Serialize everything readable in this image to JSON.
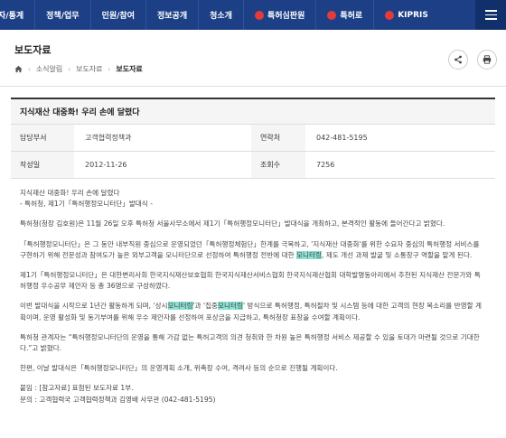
{
  "nav": {
    "items": [
      "자/통계",
      "정책/업무",
      "민원/참여",
      "정보공개",
      "청소개"
    ],
    "ext_links": [
      "특허심판원",
      "특허로",
      "KIPRIS"
    ]
  },
  "header": {
    "title": "보도자료",
    "breadcrumb": [
      "소식알림",
      "보도자료",
      "보도자료"
    ]
  },
  "article": {
    "title": "지식재산 대중화! 우리 손에 달렸다",
    "dept_label": "담당부서",
    "dept_value": "고객협력정책과",
    "contact_label": "연락처",
    "contact_value": "042-481-5195",
    "date_label": "작성일",
    "date_value": "2012-11-26",
    "views_label": "조회수",
    "views_value": "7256",
    "body": {
      "line1": "지식재산 대중화! 우리 손에 달렸다",
      "line2": "- 특허청, 제1기「특허행정모니터단」발대식 -",
      "p1": "특허청(청장 김호원)은 11월 26일 오후 특허청 서울사무소에서 제1기「특허행정모니터단」발대식을 개최하고, 본격적인 활동에 들어간다고 밝혔다.",
      "p2a": "「특허행정모니터단」은 그 동안 내부직원 중심으로 운영되었던「특허행정체험단」한계를 극복하고, '지식재산 대중화'를 위한 수요자 중심의 특허행정 서비스를 구현하기 위해 전문성과 참여도가 높은 외부고객을 모니터단으로 선정하여 특허행정 전반에 대한 ",
      "p2hl": "모니터링",
      "p2b": ", 제도 개선 과제 발굴 및 소통창구 역할을 맡게 된다.",
      "p3": "제1기「특허행정모니터단」은 대한변리사회 한국지식재산보호협회 한국지식재산서비스협회 한국지식재산협회 대학발명동아리에서 추천된 지식재산 전문가와 특허행정 우수공무 제안자 등 총 36명으로 구성하였다.",
      "p4a": "이번 발대식을 시작으로 1년간 활동하게 되며, '상시",
      "p4hl1": "모니터링",
      "p4b": "'과 '집중",
      "p4hl2": "모니터링",
      "p4c": "' 방식으로 특허행정, 특허절차 및 시스템 등에 대한 고객의 현장 목소리를 반영할 계획이며, 운영 활성화 및 동기부여를 위해 우수 제안자를 선정하여 포상금을 지급하고, 특허청장 표창을 수여할 계획이다.",
      "p5": "특허청 관계자는 “특허행정모니터단의 운영을 통해 가감 없는 특허고객의 의견 청취와 한 차원 높은 특허행정 서비스 제공할 수 있을 토대가 마련될 것으로 기대한다.”고 밝혔다.",
      "p6": "한편, 이날 발대식은「특허행정모니터단」의 운영계획 소개, 위촉장 수여, 격려사 등의 순으로 진행될 계획이다.",
      "attach": "붙임 : [참고자료] 표첨된 보도자료 1부.",
      "contact": "문의 : 고객협력국 고객협력정책과 김영배 사무관 (042-481-5195)"
    }
  }
}
